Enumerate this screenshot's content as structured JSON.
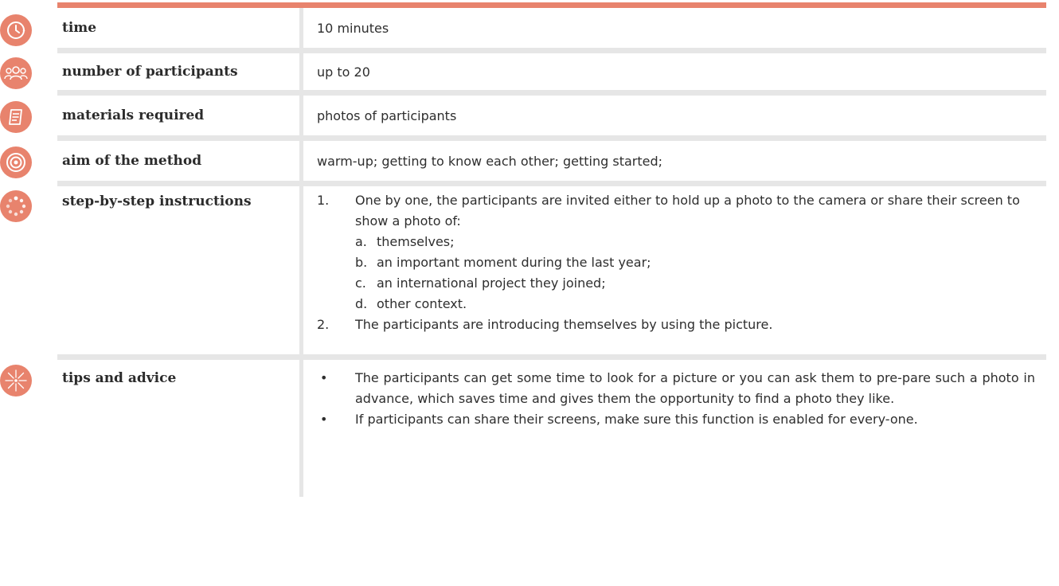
{
  "colors": {
    "accent": "#e8836d",
    "divider": "#e6e6e6"
  },
  "rows": [
    {
      "icon": "clock-icon",
      "label": "time",
      "value": "10 minutes"
    },
    {
      "icon": "participants-icon",
      "label": "number of participants",
      "value": "up to 20"
    },
    {
      "icon": "document-icon",
      "label": "materials required",
      "value": "photos of participants"
    },
    {
      "icon": "target-icon",
      "label": "aim of the method",
      "value": "warm-up; getting to know each other; getting started;"
    }
  ],
  "steps": {
    "icon": "steps-icon",
    "label": "step-by-step instructions",
    "items": [
      {
        "num": "1.",
        "text": "One by one, the participants are invited either to hold up a photo to the camera or share their screen to show a photo of:"
      },
      {
        "num": "2.",
        "text": "The participants are introducing themselves by using the picture."
      }
    ],
    "subitems": [
      {
        "letter": "a.",
        "text": "themselves;"
      },
      {
        "letter": "b.",
        "text": "an important moment during the last year;"
      },
      {
        "letter": "c.",
        "text": "an international project they joined;"
      },
      {
        "letter": "d.",
        "text": "other context."
      }
    ]
  },
  "tips": {
    "icon": "spark-icon",
    "label": "tips and advice",
    "items": [
      {
        "bullet": "•",
        "text": "The participants can get some time to look for a picture or you can ask them to pre-pare such a photo in advance, which saves time and gives them the opportunity to find a photo they like."
      },
      {
        "bullet": "•",
        "text": "If participants can share their screens, make sure this function is enabled for every-one."
      }
    ]
  }
}
